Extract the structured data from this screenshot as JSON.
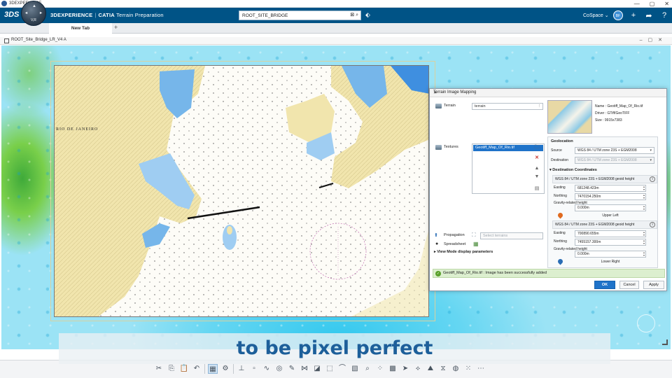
{
  "os": {
    "title": "3DEXPERIENCE",
    "min": "—",
    "max": "▢",
    "close": "✕"
  },
  "header": {
    "ds_logo": "3DS",
    "compass_version": "V,R",
    "brand_platform": "3DEXPERIENCE",
    "brand_app": "CATIA",
    "brand_role": "Terrain Preparation",
    "search_value": "ROOT_SITE_BRIDGE",
    "cospace_label": "CoSpace",
    "avatar_initials": "BF",
    "colors": {
      "bar": "#005386",
      "accent": "#1f73c9"
    }
  },
  "tabs": {
    "active": "New Tab",
    "add": "+"
  },
  "document": {
    "title": "ROOT_Site_Bridge_LR_V4 A"
  },
  "map": {
    "city_label": "RIO DE JANEIRO"
  },
  "dialog": {
    "title": "Terrain Image Mapping",
    "terrain_label": "Terrain",
    "terrain_value": "terrain",
    "textures_label": "Textures",
    "textures_items": [
      "Geotiff_Map_Of_Rio.tif"
    ],
    "propagation_label": "Propagation",
    "propagation_placeholder": "Select terrains",
    "spreadsheet_label": "Spreadsheet",
    "view_mode_label": "View Mode display parameters",
    "info_name": "Name : Geotiff_Map_Of_Rio.tif",
    "info_driver": "Driver : GTiff/GeoTIFF",
    "info_size": "Size :    9915x7383",
    "geolocation_head": "Geolocation",
    "source_label": "Source",
    "source_value": "WGS 84 / UTM zone 23S + EGM2008",
    "destination_label": "Destination",
    "destination_value": "WGS 84 / UTM zone 23S + EGM2008",
    "dest_coords_head": "Destination Coordinates",
    "crs_text": "WGS 84 / UTM zone 23S + EGM2008 geoid height",
    "easting_label": "Easting",
    "northing_label": "Northing",
    "gravity_label": "Gravity-related height",
    "upper_left": {
      "easting": "681248.423m",
      "northing": "7470154.250m",
      "height": "0.000m",
      "label": "Upper Left"
    },
    "lower_right": {
      "easting": "700890.655m",
      "northing": "7455157.300m",
      "height": "0.000m",
      "label": "Lower Right"
    },
    "success_msg": "Geotiff_Map_Of_Rio.tif : Image has been successfully added",
    "ok": "OK",
    "cancel": "Cancel",
    "apply": "Apply"
  },
  "caption": {
    "text": "to be pixel perfect"
  }
}
